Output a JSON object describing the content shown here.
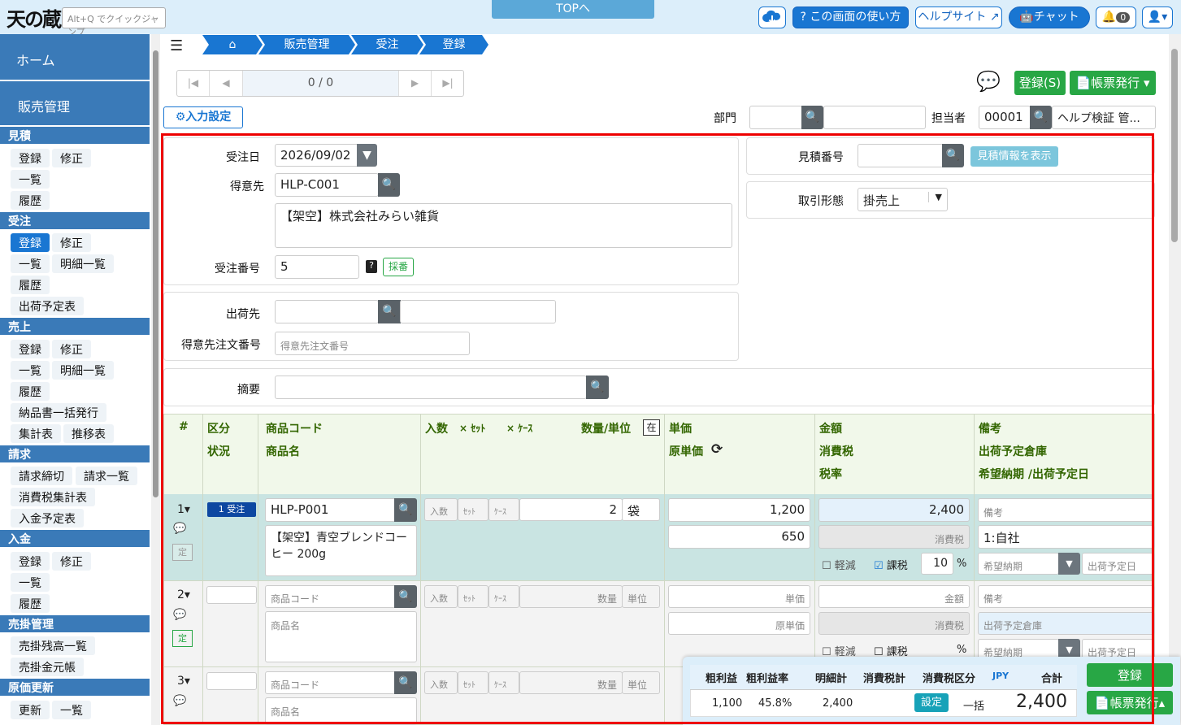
{
  "app": {
    "logo": "天の蔵",
    "quickjump_placeholder": "Alt+Q でクイックジャンプ",
    "top_link": "TOPへ"
  },
  "header": {
    "help_screen": "? この画面の使い方",
    "help_site": "ヘルプサイト",
    "chat": "チャット",
    "notifications": "0"
  },
  "sidebar": {
    "home": "ホーム",
    "sales": "販売管理",
    "sections": [
      {
        "title": "見積",
        "items": [
          "登録",
          "修正",
          "一覧",
          "履歴"
        ]
      },
      {
        "title": "受注",
        "items": [
          "登録",
          "修正",
          "一覧",
          "明細一覧",
          "履歴",
          "出荷予定表"
        ]
      },
      {
        "title": "売上",
        "items": [
          "登録",
          "修正",
          "一覧",
          "明細一覧",
          "履歴",
          "納品書一括発行",
          "集計表",
          "推移表"
        ]
      },
      {
        "title": "請求",
        "items": [
          "請求締切",
          "請求一覧",
          "消費税集計表",
          "入金予定表"
        ]
      },
      {
        "title": "入金",
        "items": [
          "登録",
          "修正",
          "一覧",
          "履歴"
        ]
      },
      {
        "title": "売掛管理",
        "items": [
          "売掛残高一覧",
          "売掛金元帳"
        ]
      },
      {
        "title": "原価更新",
        "items": [
          "更新",
          "一覧"
        ]
      }
    ]
  },
  "breadcrumb": {
    "home_icon": "home-icon",
    "items": [
      "販売管理",
      "受注",
      "登録"
    ]
  },
  "pager": {
    "text": "0 / 0"
  },
  "actions": {
    "register": "登録(S)",
    "form_issue": "帳票発行"
  },
  "input_settings": "入力設定",
  "dept": {
    "label": "部門",
    "code": "",
    "name": ""
  },
  "staff": {
    "label": "担当者",
    "code": "00001",
    "name": "ヘルプ検証 管..."
  },
  "form": {
    "order_date_label": "受注日",
    "order_date": "2026/09/02",
    "customer_label": "得意先",
    "customer_code": "HLP-C001",
    "customer_name": "【架空】株式会社みらい雑貨",
    "order_no_label": "受注番号",
    "order_no": "5",
    "numbering": "採番",
    "ship_to_label": "出荷先",
    "customer_order_label": "得意先注文番号",
    "customer_order_placeholder": "得意先注文番号",
    "summary_label": "摘要",
    "quote_no_label": "見積番号",
    "show_quote": "見積情報を表示",
    "deal_type_label": "取引形態",
    "deal_type": "掛売上"
  },
  "grid": {
    "headers": {
      "no": "#",
      "kubun": "区分",
      "status": "状況",
      "code": "商品コード",
      "name": "商品名",
      "irisu": "入数",
      "set": "ｾｯﾄ",
      "case": "ｹｰｽ",
      "qty_unit": "数量/単位",
      "zai": "在",
      "price": "単価",
      "cost": "原単価",
      "amount": "金額",
      "tax": "消費税",
      "rate": "税率",
      "note": "備考",
      "warehouse": "出荷予定倉庫",
      "dates": "希望納期 /出荷予定日"
    },
    "rows": [
      {
        "no": "1",
        "status": "1 受注",
        "code": "HLP-P001",
        "name": "【架空】青空ブレンドコーヒー 200g",
        "qty": "2",
        "unit": "袋",
        "price": "1,200",
        "cost": "650",
        "amount": "2,400",
        "tax_ph": "消費税",
        "reduced": "軽減",
        "taxed": "課税",
        "rate": "10",
        "pct": "%",
        "note_ph": "備考",
        "warehouse": "1:自社",
        "deliv_ph": "希望納期",
        "ship_ph": "出荷予定日",
        "fixed": "定"
      },
      {
        "no": "2",
        "code_ph": "商品コード",
        "name_ph": "商品名",
        "qty_ph": "数量",
        "unit_ph": "単位",
        "price_ph": "単価",
        "cost_ph": "原単価",
        "amount_ph": "金額",
        "tax_ph": "消費税",
        "reduced": "軽減",
        "taxed": "課税",
        "pct": "%",
        "note_ph": "備考",
        "warehouse_ph": "出荷予定倉庫",
        "deliv_ph": "希望納期",
        "ship_ph": "出荷予定日",
        "fixed": "定"
      },
      {
        "no": "3",
        "code_ph": "商品コード",
        "name_ph": "商品名",
        "qty_ph": "数量",
        "unit_ph": "単位"
      }
    ]
  },
  "summary": {
    "headers": [
      "粗利益",
      "粗利益率",
      "明細計",
      "消費税計",
      "消費税区分",
      "JPY",
      "合計"
    ],
    "gross": "1,100",
    "rate": "45.8%",
    "subtotal": "2,400",
    "tax_total": "",
    "setting": "設定",
    "lump": "一括",
    "total": "2,400",
    "register": "登録",
    "form_issue": "帳票発行"
  },
  "colors": {
    "primary": "#1976d2",
    "success": "#28a745",
    "sidebar": "#3a7ab8",
    "header_bg": "#f1f8ea",
    "row_bg": "#c9e4e2",
    "alert": "#e00000"
  }
}
